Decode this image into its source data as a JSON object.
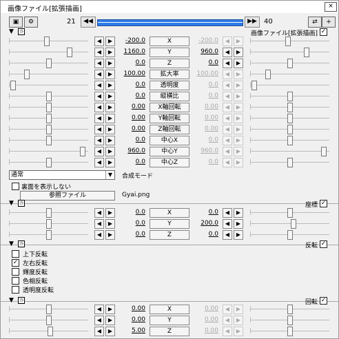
{
  "window": {
    "title": "画像ファイル[拡張描画]",
    "close_label": "×"
  },
  "toolbar": {
    "frame_start": "21",
    "frame_end": "40",
    "prev_label": "◀◀",
    "next_label": "▶▶",
    "icon1": "▣",
    "icon2": "⚙",
    "icon3": "⇄",
    "icon4": "+"
  },
  "sections": {
    "image": {
      "label": "画像ファイル[拡張描画]",
      "toggle": "▼",
      "checked": "✓"
    },
    "coords": {
      "label": "座標",
      "toggle": "▼",
      "checked": "✓"
    },
    "flip": {
      "label": "反転",
      "toggle": "▼",
      "checked": "✓"
    },
    "rotate": {
      "label": "回転",
      "toggle": "▼",
      "checked": "✓"
    }
  },
  "params": [
    {
      "label": "X",
      "start": "-200.0",
      "end": "-200.0",
      "end_disabled": true,
      "level1": 0.47,
      "level2": 0.47
    },
    {
      "label": "Y",
      "start": "1160.0",
      "end": "960.0",
      "end_disabled": false,
      "level1": 0.78,
      "level2": 0.72
    },
    {
      "label": "Z",
      "start": "0.0",
      "end": "0.0",
      "end_disabled": false,
      "level1": 0.5,
      "level2": 0.5
    },
    {
      "label": "拡大率",
      "start": "100.00",
      "end": "100.00",
      "end_disabled": true,
      "level1": 0.2,
      "level2": 0.2
    },
    {
      "label": "透明度",
      "start": "0.0",
      "end": "0.0",
      "end_disabled": true,
      "level1": 0.02,
      "level2": 0.02
    },
    {
      "label": "縦横比",
      "start": "0.0",
      "end": "0.0",
      "end_disabled": true,
      "level1": 0.5,
      "level2": 0.5
    },
    {
      "label": "X軸回転",
      "start": "0.00",
      "end": "0.00",
      "end_disabled": true,
      "level1": 0.5,
      "level2": 0.5
    },
    {
      "label": "Y軸回転",
      "start": "0.00",
      "end": "0.00",
      "end_disabled": true,
      "level1": 0.5,
      "level2": 0.5
    },
    {
      "label": "Z軸回転",
      "start": "0.00",
      "end": "0.00",
      "end_disabled": true,
      "level1": 0.5,
      "level2": 0.5
    },
    {
      "label": "中心X",
      "start": "0.0",
      "end": "0.0",
      "end_disabled": true,
      "level1": 0.5,
      "level2": 0.5
    },
    {
      "label": "中心Y",
      "start": "960.0",
      "end": "960.0",
      "end_disabled": true,
      "level1": 0.95,
      "level2": 0.95
    },
    {
      "label": "中心Z",
      "start": "0.0",
      "end": "0.0",
      "end_disabled": true,
      "level1": 0.5,
      "level2": 0.5
    }
  ],
  "blend": {
    "value": "通常",
    "label": "合成モード",
    "arrow": "▼"
  },
  "backface": {
    "label": "裏面を表示しない",
    "checked": ""
  },
  "file": {
    "button": "参照ファイル",
    "name": "Gyai.png"
  },
  "coords": [
    {
      "label": "X",
      "start": "0.0",
      "end": "0.0",
      "level1": 0.5,
      "level2": 0.5
    },
    {
      "label": "Y",
      "start": "0.0",
      "end": "200.0",
      "level1": 0.5,
      "level2": 0.55
    },
    {
      "label": "Z",
      "start": "0.0",
      "end": "0.0",
      "level1": 0.5,
      "level2": 0.5
    }
  ],
  "flip": [
    {
      "label": "上下反転",
      "checked": ""
    },
    {
      "label": "左右反転",
      "checked": "✓"
    },
    {
      "label": "輝度反転",
      "checked": ""
    },
    {
      "label": "色相反転",
      "checked": ""
    },
    {
      "label": "透明度反転",
      "checked": ""
    }
  ],
  "rotate": [
    {
      "label": "X",
      "start": "0.00",
      "end": "0.00",
      "level1": 0.5,
      "level2": 0.5
    },
    {
      "label": "Y",
      "start": "0.00",
      "end": "0.00",
      "level1": 0.5,
      "level2": 0.5
    },
    {
      "label": "Z",
      "start": "5.00",
      "end": "0.00",
      "level1": 0.52,
      "level2": 0.5
    }
  ],
  "arrows": {
    "left": "◀",
    "right": "▶"
  }
}
